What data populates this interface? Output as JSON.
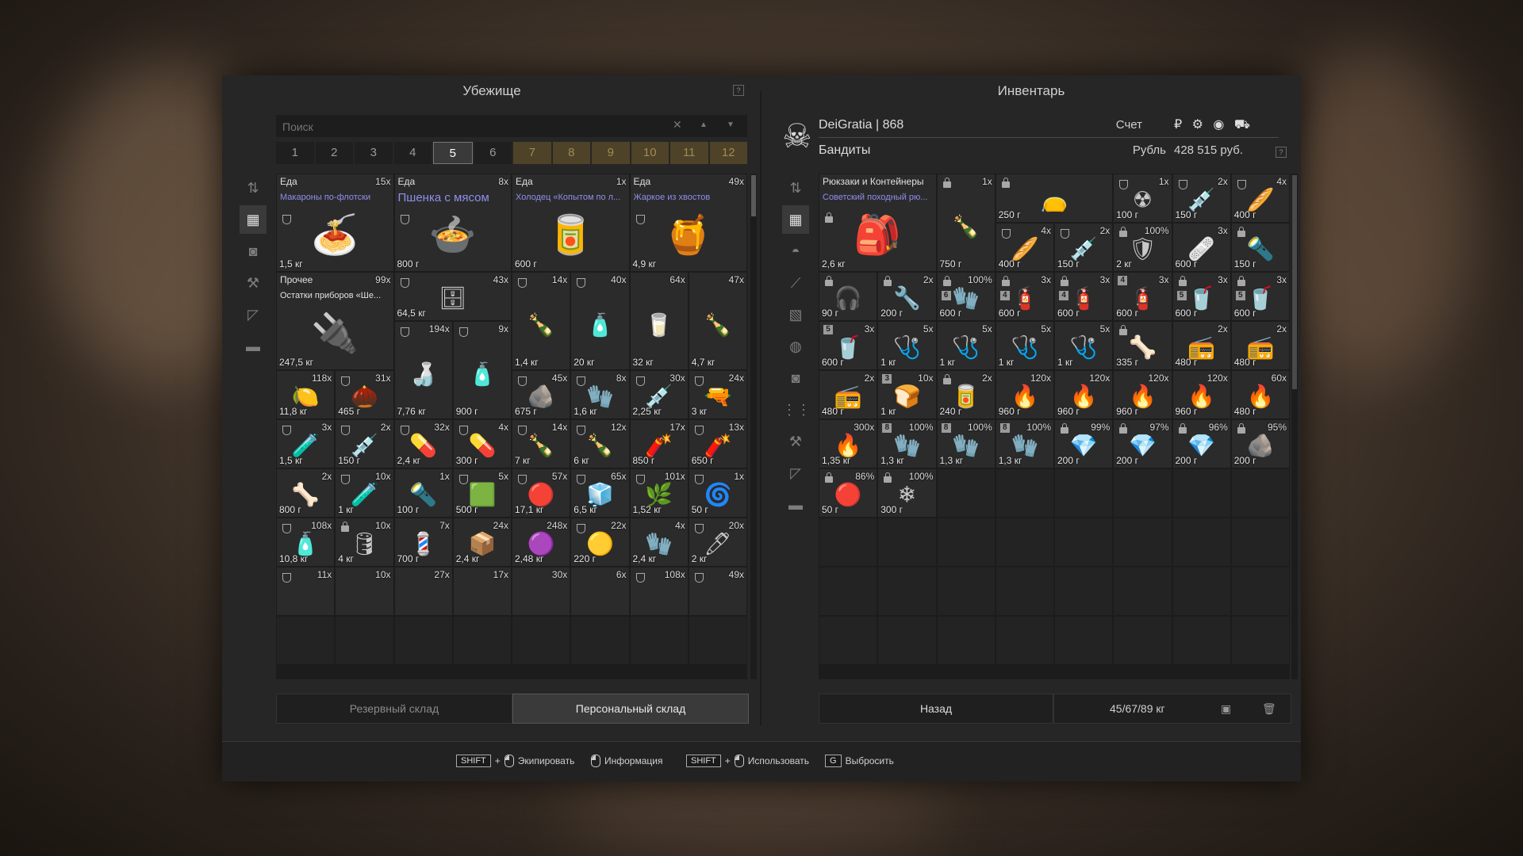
{
  "stash": {
    "title": "Убежище",
    "search_placeholder": "Поиск",
    "tabs": [
      {
        "label": "1",
        "state": "normal"
      },
      {
        "label": "2",
        "state": "normal"
      },
      {
        "label": "3",
        "state": "normal"
      },
      {
        "label": "4",
        "state": "normal"
      },
      {
        "label": "5",
        "state": "active"
      },
      {
        "label": "6",
        "state": "normal"
      },
      {
        "label": "7",
        "state": "locked"
      },
      {
        "label": "8",
        "state": "locked"
      },
      {
        "label": "9",
        "state": "locked"
      },
      {
        "label": "10",
        "state": "locked"
      },
      {
        "label": "11",
        "state": "locked"
      },
      {
        "label": "12",
        "state": "locked"
      }
    ],
    "side_icons": [
      "sort-icon",
      "grid-icon",
      "camera-icon",
      "tools-icon",
      "ruler-icon",
      "box-icon"
    ],
    "items": [
      {
        "c": 0,
        "r": 0,
        "w": 2,
        "h": 2,
        "category": "Еда",
        "name": "Макароны по-флотски",
        "count": "15x",
        "weight": "1,5 кг",
        "icon": "🍝",
        "mark": "shield"
      },
      {
        "c": 2,
        "r": 0,
        "w": 2,
        "h": 2,
        "category": "Еда",
        "name": "Пшенка с мясом",
        "name_big": true,
        "count": "8x",
        "weight": "800 г",
        "icon": "🍲",
        "mark": "shield"
      },
      {
        "c": 4,
        "r": 0,
        "w": 2,
        "h": 2,
        "category": "Еда",
        "name": "Холодец «Копытом по л...",
        "count": "1x",
        "weight": "600 г",
        "icon": "🥫",
        "mark": ""
      },
      {
        "c": 6,
        "r": 0,
        "w": 2,
        "h": 2,
        "category": "Еда",
        "name": "Жаркое из хвостов",
        "count": "49x",
        "weight": "4,9 кг",
        "icon": "🍯",
        "mark": "shield"
      },
      {
        "c": 0,
        "r": 2,
        "w": 2,
        "h": 2,
        "category": "Прочее",
        "name": "Остатки приборов «Ше...",
        "name_white": true,
        "count": "99x",
        "weight": "247,5 кг",
        "icon": "🔌",
        "mark": ""
      },
      {
        "c": 2,
        "r": 2,
        "w": 2,
        "h": 1,
        "count": "43x",
        "weight": "64,5 кг",
        "icon": "🗄",
        "mark": "shield"
      },
      {
        "c": 4,
        "r": 2,
        "w": 1,
        "h": 2,
        "count": "14x",
        "weight": "1,4 кг",
        "icon": "🍾",
        "mark": "shield"
      },
      {
        "c": 5,
        "r": 2,
        "w": 1,
        "h": 2,
        "count": "40x",
        "weight": "20 кг",
        "icon": "🧴",
        "mark": "shield"
      },
      {
        "c": 6,
        "r": 2,
        "w": 1,
        "h": 2,
        "count": "64x",
        "weight": "32 кг",
        "icon": "🥛",
        "mark": ""
      },
      {
        "c": 7,
        "r": 2,
        "w": 1,
        "h": 2,
        "count": "47x",
        "weight": "4,7 кг",
        "icon": "🍾",
        "mark": ""
      },
      {
        "c": 2,
        "r": 3,
        "w": 1,
        "h": 2,
        "count": "194x",
        "weight": "7,76 кг",
        "icon": "🍶",
        "mark": "shield"
      },
      {
        "c": 3,
        "r": 3,
        "w": 1,
        "h": 2,
        "count": "9x",
        "weight": "900 г",
        "icon": "🧴",
        "mark": "shield"
      },
      {
        "c": 0,
        "r": 4,
        "w": 1,
        "h": 1,
        "count": "118x",
        "weight": "11,8 кг",
        "icon": "🍋",
        "mark": ""
      },
      {
        "c": 1,
        "r": 4,
        "w": 1,
        "h": 1,
        "count": "31x",
        "weight": "465 г",
        "icon": "🌰",
        "mark": "shield"
      },
      {
        "c": 4,
        "r": 4,
        "w": 1,
        "h": 1,
        "count": "45x",
        "weight": "675 г",
        "icon": "🪨",
        "mark": "shield"
      },
      {
        "c": 5,
        "r": 4,
        "w": 1,
        "h": 1,
        "count": "8x",
        "weight": "1,6 кг",
        "icon": "🧤",
        "mark": "shield"
      },
      {
        "c": 6,
        "r": 4,
        "w": 1,
        "h": 1,
        "count": "30x",
        "weight": "2,25 кг",
        "icon": "💉",
        "mark": "shield"
      },
      {
        "c": 7,
        "r": 4,
        "w": 1,
        "h": 1,
        "count": "24x",
        "weight": "3 кг",
        "icon": "🔫",
        "mark": "shield"
      },
      {
        "c": 0,
        "r": 5,
        "w": 1,
        "h": 1,
        "count": "3x",
        "weight": "1,5 кг",
        "icon": "🧪",
        "mark": "shield"
      },
      {
        "c": 1,
        "r": 5,
        "w": 1,
        "h": 1,
        "count": "2x",
        "weight": "150 г",
        "icon": "💉",
        "mark": "shield"
      },
      {
        "c": 2,
        "r": 5,
        "w": 1,
        "h": 1,
        "count": "32x",
        "weight": "2,4 кг",
        "icon": "💊",
        "mark": "shield"
      },
      {
        "c": 3,
        "r": 5,
        "w": 1,
        "h": 1,
        "count": "4x",
        "weight": "300 г",
        "icon": "💊",
        "mark": "shield"
      },
      {
        "c": 4,
        "r": 5,
        "w": 1,
        "h": 1,
        "count": "14x",
        "weight": "7 кг",
        "icon": "🍾",
        "mark": "shield"
      },
      {
        "c": 5,
        "r": 5,
        "w": 1,
        "h": 1,
        "count": "12x",
        "weight": "6 кг",
        "icon": "🍾",
        "mark": "shield"
      },
      {
        "c": 6,
        "r": 5,
        "w": 1,
        "h": 1,
        "count": "17x",
        "weight": "850 г",
        "icon": "🧨",
        "mark": ""
      },
      {
        "c": 7,
        "r": 5,
        "w": 1,
        "h": 1,
        "count": "13x",
        "weight": "650 г",
        "icon": "🧨",
        "mark": "shield"
      },
      {
        "c": 0,
        "r": 6,
        "w": 1,
        "h": 1,
        "count": "2x",
        "weight": "800 г",
        "icon": "🦴",
        "mark": ""
      },
      {
        "c": 1,
        "r": 6,
        "w": 1,
        "h": 1,
        "count": "10x",
        "weight": "1 кг",
        "icon": "🧪",
        "mark": "shield"
      },
      {
        "c": 2,
        "r": 6,
        "w": 1,
        "h": 1,
        "count": "1x",
        "weight": "100 г",
        "icon": "🔦",
        "mark": ""
      },
      {
        "c": 3,
        "r": 6,
        "w": 1,
        "h": 1,
        "count": "5x",
        "weight": "500 г",
        "icon": "🟩",
        "mark": "shield"
      },
      {
        "c": 4,
        "r": 6,
        "w": 1,
        "h": 1,
        "count": "57x",
        "weight": "17,1 кг",
        "icon": "🔴",
        "mark": "shield"
      },
      {
        "c": 5,
        "r": 6,
        "w": 1,
        "h": 1,
        "count": "65x",
        "weight": "6,5 кг",
        "icon": "🧊",
        "mark": "shield"
      },
      {
        "c": 6,
        "r": 6,
        "w": 1,
        "h": 1,
        "count": "101x",
        "weight": "1,52 кг",
        "icon": "🌿",
        "mark": "shield"
      },
      {
        "c": 7,
        "r": 6,
        "w": 1,
        "h": 1,
        "count": "1x",
        "weight": "50 г",
        "icon": "🌀",
        "mark": "shield"
      },
      {
        "c": 0,
        "r": 7,
        "w": 1,
        "h": 1,
        "count": "108x",
        "weight": "10,8 кг",
        "icon": "🧴",
        "mark": "shield"
      },
      {
        "c": 1,
        "r": 7,
        "w": 1,
        "h": 1,
        "count": "10x",
        "weight": "4 кг",
        "icon": "🛢",
        "mark": "lock"
      },
      {
        "c": 2,
        "r": 7,
        "w": 1,
        "h": 1,
        "count": "7x",
        "weight": "700 г",
        "icon": "💈",
        "mark": ""
      },
      {
        "c": 3,
        "r": 7,
        "w": 1,
        "h": 1,
        "count": "24x",
        "weight": "2,4 кг",
        "icon": "📦",
        "mark": ""
      },
      {
        "c": 4,
        "r": 7,
        "w": 1,
        "h": 1,
        "count": "248x",
        "weight": "2,48 кг",
        "icon": "🟣",
        "mark": ""
      },
      {
        "c": 5,
        "r": 7,
        "w": 1,
        "h": 1,
        "count": "22x",
        "weight": "220 г",
        "icon": "🟡",
        "mark": "shield"
      },
      {
        "c": 6,
        "r": 7,
        "w": 1,
        "h": 1,
        "count": "4x",
        "weight": "2,4 кг",
        "icon": "🧤",
        "mark": ""
      },
      {
        "c": 7,
        "r": 7,
        "w": 1,
        "h": 1,
        "count": "20x",
        "weight": "2 кг",
        "icon": "🖊",
        "mark": "shield"
      },
      {
        "c": 0,
        "r": 8,
        "w": 1,
        "h": 1,
        "count": "11x",
        "weight": "",
        "icon": "",
        "mark": "shield"
      },
      {
        "c": 1,
        "r": 8,
        "w": 1,
        "h": 1,
        "count": "10x",
        "weight": "",
        "icon": "",
        "mark": ""
      },
      {
        "c": 2,
        "r": 8,
        "w": 1,
        "h": 1,
        "count": "27x",
        "weight": "",
        "icon": "",
        "mark": ""
      },
      {
        "c": 3,
        "r": 8,
        "w": 1,
        "h": 1,
        "count": "17x",
        "weight": "",
        "icon": "",
        "mark": ""
      },
      {
        "c": 4,
        "r": 8,
        "w": 1,
        "h": 1,
        "count": "30x",
        "weight": "",
        "icon": "",
        "mark": ""
      },
      {
        "c": 5,
        "r": 8,
        "w": 1,
        "h": 1,
        "count": "6x",
        "weight": "",
        "icon": "",
        "mark": ""
      },
      {
        "c": 6,
        "r": 8,
        "w": 1,
        "h": 1,
        "count": "108x",
        "weight": "",
        "icon": "",
        "mark": "shield"
      },
      {
        "c": 7,
        "r": 8,
        "w": 1,
        "h": 1,
        "count": "49x",
        "weight": "",
        "icon": "",
        "mark": "shield"
      }
    ],
    "btn_reserve": "Резервный склад",
    "btn_personal": "Персональный склад"
  },
  "inventory": {
    "title": "Инвентарь",
    "player": "DeiGratia | 868",
    "faction": "Бандиты",
    "account_label": "Счет",
    "currency_name": "Рубль",
    "money": "428 515 руб.",
    "currency_icons": "₽ ⚙ ◉ ⛟",
    "side_icons": [
      "sort-icon",
      "grid-icon",
      "helmet-icon",
      "knife-icon",
      "armor-icon",
      "globe-icon",
      "camera-icon",
      "ammo-icon",
      "tools-icon",
      "ruler-icon",
      "box-icon"
    ],
    "items": [
      {
        "c": 0,
        "r": 0,
        "w": 2,
        "h": 2,
        "category": "Рюкзаки и Контейнеры",
        "name": "Советский походный рю...",
        "name_white": false,
        "count": "",
        "weight": "2,6 кг",
        "icon": "🎒",
        "mark": "lock"
      },
      {
        "c": 2,
        "r": 0,
        "w": 1,
        "h": 2,
        "count": "1x",
        "weight": "750 г",
        "icon": "🍾",
        "mark": "lock"
      },
      {
        "c": 3,
        "r": 0,
        "w": 2,
        "h": 1,
        "count": "",
        "weight": "250 г",
        "icon": "👝",
        "mark": "lock"
      },
      {
        "c": 5,
        "r": 0,
        "w": 1,
        "h": 1,
        "count": "1x",
        "weight": "100 г",
        "icon": "☢",
        "mark": "shield"
      },
      {
        "c": 6,
        "r": 0,
        "w": 1,
        "h": 1,
        "count": "2x",
        "weight": "150 г",
        "icon": "💉",
        "mark": "shield"
      },
      {
        "c": 7,
        "r": 0,
        "w": 1,
        "h": 1,
        "count": "4x",
        "weight": "400 г",
        "icon": "🥖",
        "mark": "shield"
      },
      {
        "c": 3,
        "r": 1,
        "w": 1,
        "h": 1,
        "count": "4x",
        "weight": "400 г",
        "icon": "🥖",
        "mark": "shield"
      },
      {
        "c": 4,
        "r": 1,
        "w": 1,
        "h": 1,
        "count": "2x",
        "weight": "150 г",
        "icon": "💉",
        "mark": "shield"
      },
      {
        "c": 5,
        "r": 1,
        "w": 1,
        "h": 1,
        "count": "100%",
        "weight": "2 кг",
        "icon": "🛡",
        "mark": "lock"
      },
      {
        "c": 6,
        "r": 1,
        "w": 1,
        "h": 1,
        "count": "3x",
        "weight": "600 г",
        "icon": "🩹",
        "mark": ""
      },
      {
        "c": 7,
        "r": 1,
        "w": 1,
        "h": 1,
        "count": "",
        "weight": "150 г",
        "icon": "🔦",
        "mark": "lock"
      },
      {
        "c": 0,
        "r": 2,
        "w": 1,
        "h": 1,
        "count": "",
        "weight": "90 г",
        "icon": "🎧",
        "mark": "lock"
      },
      {
        "c": 1,
        "r": 2,
        "w": 1,
        "h": 1,
        "count": "2x",
        "weight": "200 г",
        "icon": "🔧",
        "mark": "lock"
      },
      {
        "c": 2,
        "r": 2,
        "w": 1,
        "h": 1,
        "count": "100%",
        "weight": "600 г",
        "icon": "🧤",
        "mark": "lock",
        "tier": "6"
      },
      {
        "c": 3,
        "r": 2,
        "w": 1,
        "h": 1,
        "count": "3x",
        "weight": "600 г",
        "icon": "🧯",
        "mark": "lock",
        "tier": "4"
      },
      {
        "c": 4,
        "r": 2,
        "w": 1,
        "h": 1,
        "count": "3x",
        "weight": "600 г",
        "icon": "🧯",
        "mark": "lock",
        "tier": "4"
      },
      {
        "c": 5,
        "r": 2,
        "w": 1,
        "h": 1,
        "count": "3x",
        "weight": "600 г",
        "icon": "🧯",
        "mark": "",
        "tier": "4"
      },
      {
        "c": 6,
        "r": 2,
        "w": 1,
        "h": 1,
        "count": "3x",
        "weight": "600 г",
        "icon": "🥤",
        "mark": "lock",
        "tier": "5"
      },
      {
        "c": 7,
        "r": 2,
        "w": 1,
        "h": 1,
        "count": "3x",
        "weight": "600 г",
        "icon": "🥤",
        "mark": "lock",
        "tier": "5"
      },
      {
        "c": 0,
        "r": 3,
        "w": 1,
        "h": 1,
        "count": "3x",
        "weight": "600 г",
        "icon": "🥤",
        "mark": "",
        "tier": "5"
      },
      {
        "c": 1,
        "r": 3,
        "w": 1,
        "h": 1,
        "count": "5x",
        "weight": "1 кг",
        "icon": "🩺",
        "mark": ""
      },
      {
        "c": 2,
        "r": 3,
        "w": 1,
        "h": 1,
        "count": "5x",
        "weight": "1 кг",
        "icon": "🩺",
        "mark": ""
      },
      {
        "c": 3,
        "r": 3,
        "w": 1,
        "h": 1,
        "count": "5x",
        "weight": "1 кг",
        "icon": "🩺",
        "mark": ""
      },
      {
        "c": 4,
        "r": 3,
        "w": 1,
        "h": 1,
        "count": "5x",
        "weight": "1 кг",
        "icon": "🩺",
        "mark": ""
      },
      {
        "c": 5,
        "r": 3,
        "w": 1,
        "h": 1,
        "count": "",
        "weight": "335 г",
        "icon": "🦴",
        "mark": "lock"
      },
      {
        "c": 6,
        "r": 3,
        "w": 1,
        "h": 1,
        "count": "2x",
        "weight": "480 г",
        "icon": "📻",
        "mark": ""
      },
      {
        "c": 7,
        "r": 3,
        "w": 1,
        "h": 1,
        "count": "2x",
        "weight": "480 г",
        "icon": "📻",
        "mark": ""
      },
      {
        "c": 0,
        "r": 4,
        "w": 1,
        "h": 1,
        "count": "2x",
        "weight": "480 г",
        "icon": "📻",
        "mark": ""
      },
      {
        "c": 1,
        "r": 4,
        "w": 1,
        "h": 1,
        "count": "10x",
        "weight": "1 кг",
        "icon": "🍞",
        "mark": "",
        "tier": "3"
      },
      {
        "c": 2,
        "r": 4,
        "w": 1,
        "h": 1,
        "count": "2x",
        "weight": "240 г",
        "icon": "🥫",
        "mark": "lock"
      },
      {
        "c": 3,
        "r": 4,
        "w": 1,
        "h": 1,
        "count": "120x",
        "weight": "960 г",
        "icon": "🔥",
        "mark": ""
      },
      {
        "c": 4,
        "r": 4,
        "w": 1,
        "h": 1,
        "count": "120x",
        "weight": "960 г",
        "icon": "🔥",
        "mark": ""
      },
      {
        "c": 5,
        "r": 4,
        "w": 1,
        "h": 1,
        "count": "120x",
        "weight": "960 г",
        "icon": "🔥",
        "mark": ""
      },
      {
        "c": 6,
        "r": 4,
        "w": 1,
        "h": 1,
        "count": "120x",
        "weight": "960 г",
        "icon": "🔥",
        "mark": ""
      },
      {
        "c": 7,
        "r": 4,
        "w": 1,
        "h": 1,
        "count": "60x",
        "weight": "480 г",
        "icon": "🔥",
        "mark": ""
      },
      {
        "c": 0,
        "r": 5,
        "w": 1,
        "h": 1,
        "count": "300x",
        "weight": "1,35 кг",
        "icon": "🔥",
        "mark": ""
      },
      {
        "c": 1,
        "r": 5,
        "w": 1,
        "h": 1,
        "count": "100%",
        "weight": "1,3 кг",
        "icon": "🧤",
        "mark": "",
        "tier": "8"
      },
      {
        "c": 2,
        "r": 5,
        "w": 1,
        "h": 1,
        "count": "100%",
        "weight": "1,3 кг",
        "icon": "🧤",
        "mark": "",
        "tier": "8"
      },
      {
        "c": 3,
        "r": 5,
        "w": 1,
        "h": 1,
        "count": "100%",
        "weight": "1,3 кг",
        "icon": "🧤",
        "mark": "",
        "tier": "8"
      },
      {
        "c": 4,
        "r": 5,
        "w": 1,
        "h": 1,
        "count": "99%",
        "weight": "200 г",
        "icon": "💎",
        "mark": "lock"
      },
      {
        "c": 5,
        "r": 5,
        "w": 1,
        "h": 1,
        "count": "97%",
        "weight": "200 г",
        "icon": "💎",
        "mark": "lock"
      },
      {
        "c": 6,
        "r": 5,
        "w": 1,
        "h": 1,
        "count": "96%",
        "weight": "200 г",
        "icon": "💎",
        "mark": "lock"
      },
      {
        "c": 7,
        "r": 5,
        "w": 1,
        "h": 1,
        "count": "95%",
        "weight": "200 г",
        "icon": "🪨",
        "mark": "lock"
      },
      {
        "c": 0,
        "r": 6,
        "w": 1,
        "h": 1,
        "count": "86%",
        "weight": "50 г",
        "icon": "🔴",
        "mark": "lock"
      },
      {
        "c": 1,
        "r": 6,
        "w": 1,
        "h": 1,
        "count": "100%",
        "weight": "300 г",
        "icon": "❄",
        "mark": "lock"
      }
    ],
    "btn_back": "Назад",
    "weight_status": "45/67/89 кг"
  },
  "hints": [
    {
      "key": "SHIFT",
      "plus": "+",
      "label": "Экипировать",
      "mouse": true
    },
    {
      "key": "",
      "plus": "",
      "label": "Информация",
      "mouse": true
    },
    {
      "key": "SHIFT",
      "plus": "+",
      "label": "Использовать",
      "mouse": true
    },
    {
      "key": "G",
      "plus": "",
      "label": "Выбросить",
      "mouse": false
    }
  ]
}
